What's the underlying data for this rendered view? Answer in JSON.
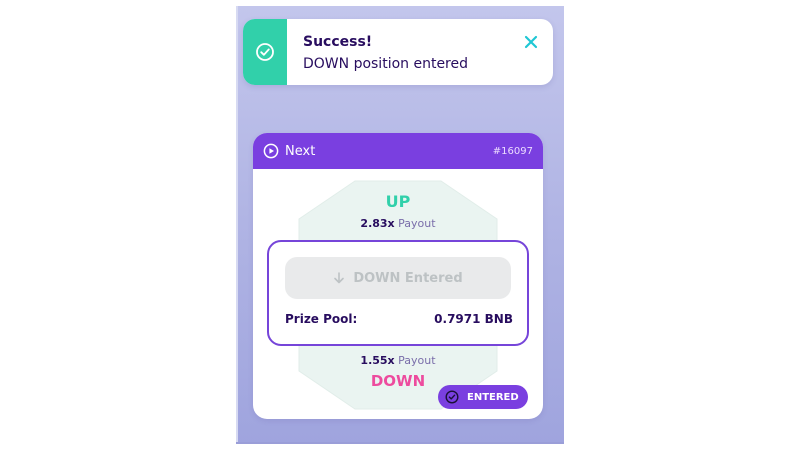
{
  "colors": {
    "success": "#31d0aa",
    "header_purple": "#7a3fe0",
    "up_green": "#31d0aa",
    "down_pink": "#ed4b9e",
    "text_dark": "#280d5f",
    "text_muted": "#7a6eaa",
    "border_purple": "#7645d9"
  },
  "toast": {
    "icon": "check-circle-icon",
    "title": "Success!",
    "message": "DOWN position entered",
    "close_icon": "close-icon"
  },
  "card": {
    "header": {
      "icon": "play-circle-icon",
      "label": "Next",
      "epoch": "#16097"
    },
    "up": {
      "label": "UP",
      "multiplier": "2.83x",
      "payout_label": "Payout"
    },
    "entered_button": {
      "icon": "arrow-down-icon",
      "label": "DOWN Entered"
    },
    "prize_pool": {
      "label": "Prize Pool:",
      "value": "0.7971 BNB"
    },
    "down": {
      "label": "DOWN",
      "multiplier": "1.55x",
      "payout_label": "Payout"
    },
    "badge": {
      "icon": "check-circle-icon",
      "label": "ENTERED"
    }
  }
}
